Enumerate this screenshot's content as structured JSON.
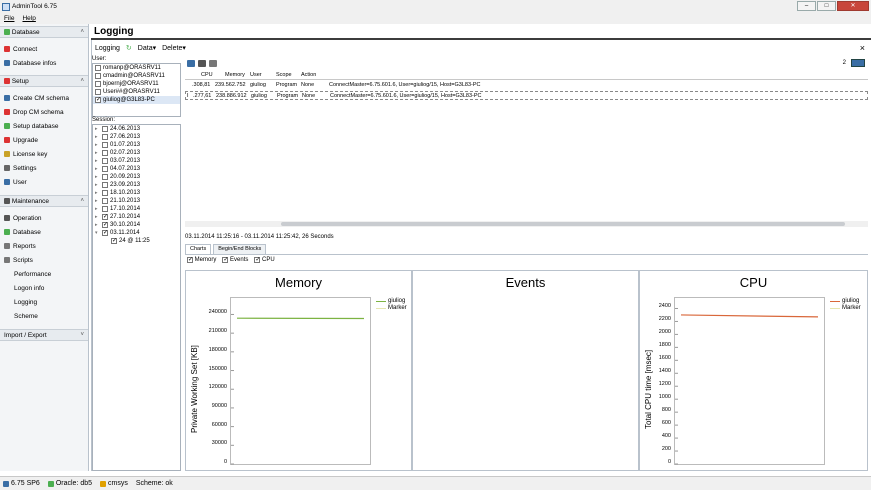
{
  "app_title": "AdminTool 6.75",
  "menu": [
    "File",
    "Help"
  ],
  "left": {
    "sec_database": "Database",
    "connect": "Connect",
    "database_infos": "Database infos",
    "sec_setup": "Setup",
    "create_cm_schema": "Create CM schema",
    "drop_cm_schema": "Drop CM schema",
    "setup_database": "Setup database",
    "upgrade": "Upgrade",
    "license_key": "License key",
    "settings": "Settings",
    "user": "User",
    "sec_maintenance": "Maintenance",
    "operation": "Operation",
    "database": "Database",
    "reports": "Reports",
    "scripts": "Scripts",
    "performance": "Performance",
    "logon_info": "Logon info",
    "logging": "Logging",
    "scheme": "Scheme",
    "sec_import": "Import / Export"
  },
  "main": {
    "title": "Logging",
    "toolbar": {
      "logging": "Logging",
      "data": "Data",
      "delete": "Delete",
      "close": "×"
    },
    "user_label": "User:",
    "users": [
      {
        "name": "romanp@ORASRV11",
        "checked": false
      },
      {
        "name": "cmadmin@ORASRV11",
        "checked": false
      },
      {
        "name": "bjoernj@ORASRV11",
        "checked": false
      },
      {
        "name": "User##@ORASRV11",
        "checked": false
      },
      {
        "name": "giuliog@G3L83-PC",
        "checked": true
      }
    ],
    "session_label": "Session:",
    "sessions": [
      {
        "name": "24.06.2013",
        "checked": false
      },
      {
        "name": "27.06.2013",
        "checked": false
      },
      {
        "name": "01.07.2013",
        "checked": false
      },
      {
        "name": "02.07.2013",
        "checked": false
      },
      {
        "name": "03.07.2013",
        "checked": false
      },
      {
        "name": "04.07.2013",
        "checked": false
      },
      {
        "name": "20.09.2013",
        "checked": false
      },
      {
        "name": "23.09.2013",
        "checked": false
      },
      {
        "name": "18.10.2013",
        "checked": false
      },
      {
        "name": "21.10.2013",
        "checked": false
      },
      {
        "name": "17.10.2014",
        "checked": false
      },
      {
        "name": "27.10.2014",
        "checked": true
      },
      {
        "name": "30.10.2014",
        "checked": true
      },
      {
        "name": "03.11.2014",
        "checked": true
      }
    ],
    "session_child": "24 @ 11:25",
    "grid": {
      "page": "2",
      "headers": [
        "CPU",
        "Memory",
        "User",
        "Scope",
        "Action"
      ],
      "rows": [
        {
          "marker": "",
          "cpu": ".308,81",
          "memory": "239.562.752",
          "user": "giuliog",
          "scope": "Program",
          "action": "None",
          "detail": "ConnectMaster=6.75.601.6, User=giuliog/15, Host=G3L83-PC"
        },
        {
          "marker": "I",
          "cpu": ".277,61",
          "memory": "238.886.912",
          "user": "giuliog",
          "scope": "Program",
          "action": "None",
          "detail": "ConnectMaster=6.75.601.6, User=giuliog/15, Host=G3L83-PC"
        }
      ]
    },
    "time_range": "03.11.2014 11:25:16 - 03.11.2014 11:25:42,  26 Seconds",
    "tabs": [
      "Charts",
      "Begin/End Blocks"
    ],
    "options": [
      "Memory",
      "Events",
      "CPU"
    ]
  },
  "chart_data": [
    {
      "type": "line",
      "title": "Memory",
      "ylabel": "Private Working Set  [KB]",
      "ylim": [
        0,
        260000
      ],
      "yticks": [
        0,
        30000,
        60000,
        90000,
        120000,
        150000,
        180000,
        210000,
        240000
      ],
      "series": [
        {
          "name": "giuliog",
          "color": "#7cb342",
          "values": [
            234000,
            233500
          ]
        },
        {
          "name": "Marker",
          "color": "#e6e6b0",
          "values": []
        }
      ]
    },
    {
      "type": "line",
      "title": "Events",
      "series": []
    },
    {
      "type": "line",
      "title": "CPU",
      "ylabel": "Total CPU time [msec]",
      "ylim": [
        0,
        2500
      ],
      "yticks": [
        0,
        200,
        400,
        600,
        800,
        1000,
        1200,
        1400,
        1600,
        1800,
        2000,
        2200,
        2400
      ],
      "series": [
        {
          "name": "giuliog",
          "color": "#d9673a",
          "values": [
            2300,
            2270
          ]
        },
        {
          "name": "Marker",
          "color": "#e6e6b0",
          "values": []
        }
      ]
    }
  ],
  "status": {
    "version": "6.75 SP6",
    "oracle": "Oracle: db5",
    "cmsys": "cmsys",
    "scheme": "Scheme: ok"
  }
}
